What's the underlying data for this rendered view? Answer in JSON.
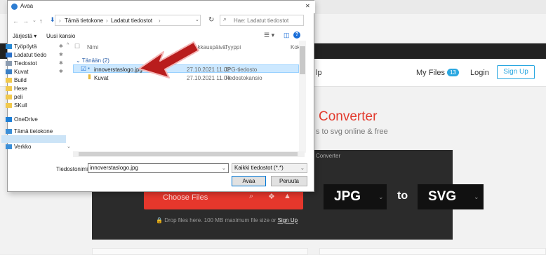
{
  "website": {
    "nav": {
      "help_partial": "lp",
      "my_files": "My Files",
      "my_files_count": "13",
      "login": "Login",
      "signup": "Sign Up"
    },
    "hero": {
      "title": "Converter",
      "subtitle": "s to svg online & free"
    },
    "panel": {
      "crumb": "Converter",
      "choose_files": "Choose Files",
      "from_format": "JPG",
      "to_word": "to",
      "to_format": "SVG",
      "drop_text": "Drop files here. 100 MB maximum file size or",
      "drop_link": "Sign Up"
    }
  },
  "dialog": {
    "title": "Avaa",
    "breadcrumb": [
      "Tämä tietokone",
      "Ladatut tiedostot"
    ],
    "search_placeholder": "Hae: Ladatut tiedostot",
    "toolbar": {
      "organize": "Järjestä ▾",
      "new_folder": "Uusi kansio"
    },
    "nav_items": [
      {
        "label": "Työpöytä",
        "color": "#2a8ad4",
        "pinned": true
      },
      {
        "label": "Ladatut tiedo",
        "color": "#2a70c8",
        "pinned": true
      },
      {
        "label": "Tiedostot",
        "color": "#8a9bb0",
        "pinned": true
      },
      {
        "label": "Kuvat",
        "color": "#3a7fc4",
        "pinned": true
      },
      {
        "label": "Build",
        "color": "#f2c94c",
        "pinned": false
      },
      {
        "label": "Hese",
        "color": "#f2c94c",
        "pinned": false
      },
      {
        "label": "peli",
        "color": "#f2c94c",
        "pinned": false
      },
      {
        "label": "SKull",
        "color": "#f2c94c",
        "pinned": false
      },
      {
        "label": "OneDrive",
        "color": "#1e7fd6",
        "pinned": false
      },
      {
        "label": "Tämä tietokone",
        "color": "#3b8fd8",
        "pinned": false,
        "selected": true
      },
      {
        "label": "Verkko",
        "color": "#3b8fd8",
        "pinned": false
      }
    ],
    "columns": [
      "Nimi",
      "Muokkauspäivä",
      "Tyyppi",
      "Koko"
    ],
    "group_label": "Tänään (2)",
    "files": [
      {
        "name": "innoverstaslogo.jpg",
        "date": "27.10.2021 11.02",
        "type": "JPG-tiedosto",
        "selected": true
      },
      {
        "name": "Kuvat",
        "date": "27.10.2021 11.04",
        "type": "Tiedostokansio",
        "selected": false
      }
    ],
    "filename_label": "Tiedostonimi:",
    "filename_value": "innoverstaslogo.jpg",
    "filetype_value": "Kaikki tiedostot (*.*)",
    "open_button": "Avaa",
    "cancel_button": "Peruuta"
  },
  "colors": {
    "accent_red": "#e6372c",
    "brand_blue": "#2aa7e0",
    "selection": "#cce8ff"
  }
}
